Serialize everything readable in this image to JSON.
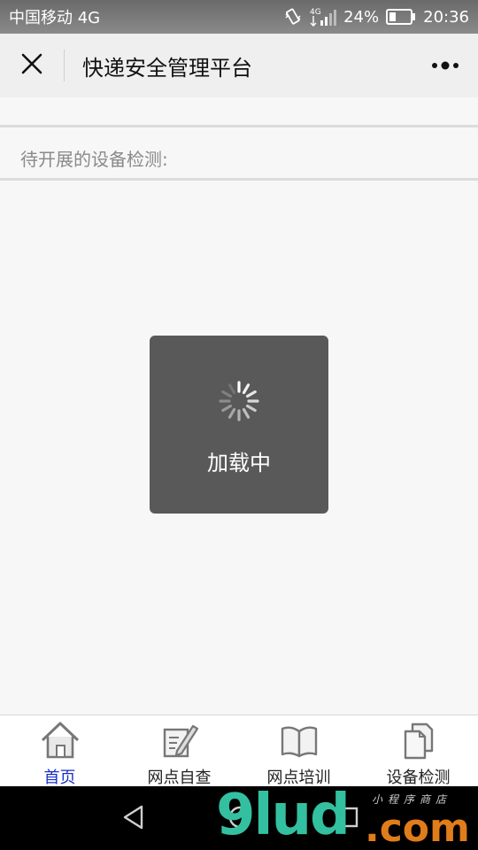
{
  "status_bar": {
    "carrier": "中国移动 4G",
    "network": "4G",
    "battery": "24%",
    "time": "20:36"
  },
  "title_bar": {
    "title": "快递安全管理平台",
    "close_icon": "close-icon",
    "more_icon": "more-icon"
  },
  "content": {
    "section_label": "待开展的设备检测:"
  },
  "loading": {
    "text": "加载中"
  },
  "tabs": [
    {
      "label": "首页",
      "icon": "home-icon",
      "active": true
    },
    {
      "label": "网点自查",
      "icon": "edit-icon",
      "active": false
    },
    {
      "label": "网点培训",
      "icon": "book-icon",
      "active": false
    },
    {
      "label": "设备检测",
      "icon": "documents-icon",
      "active": false
    }
  ],
  "watermark": {
    "brand": "9lud",
    "suffix": ".com",
    "tagline": "小程序商店"
  },
  "colors": {
    "active_tab": "#1a2ec8",
    "toast_bg": "#595959",
    "watermark_green": "#33c0a0",
    "watermark_orange": "#e07c1a"
  }
}
